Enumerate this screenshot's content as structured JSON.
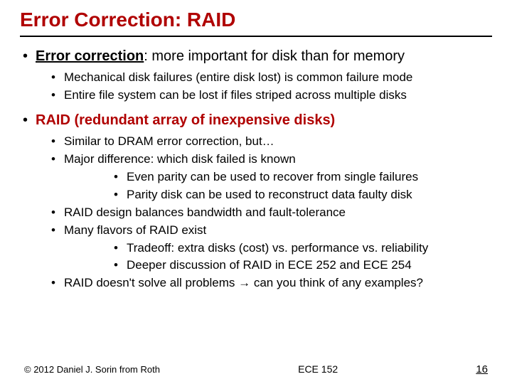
{
  "title": "Error Correction: RAID",
  "b1": {
    "lead": "Error correction",
    "rest": ": more important for disk than for memory",
    "sub": [
      "Mechanical disk failures (entire disk lost) is common failure mode",
      "Entire file system can be lost if files striped across multiple disks"
    ]
  },
  "b2": {
    "text": "RAID (redundant array of inexpensive disks)",
    "sub1": "Similar to DRAM error correction, but…",
    "sub2": "Major difference: which disk failed is known",
    "sub2_children": [
      "Even parity can be used to recover from single failures",
      "Parity disk can be used to reconstruct data faulty disk"
    ],
    "sub3": "RAID design balances bandwidth and fault-tolerance",
    "sub4": "Many flavors of RAID exist",
    "sub4_children": [
      "Tradeoff: extra disks (cost) vs. performance vs. reliability",
      "Deeper discussion of RAID in ECE 252 and ECE 254"
    ],
    "sub5": "RAID doesn't solve all problems → can you think of any examples?"
  },
  "footer": {
    "left": "© 2012 Daniel J. Sorin from Roth",
    "center": "ECE 152",
    "right": "16"
  }
}
